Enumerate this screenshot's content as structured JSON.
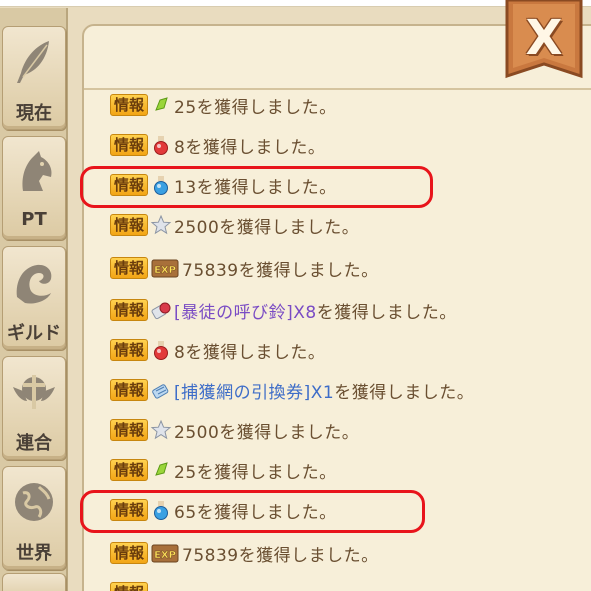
{
  "sidebar": {
    "items": [
      {
        "label": "現在",
        "icon": "feather-icon"
      },
      {
        "label": "PT",
        "icon": "horse-head-icon"
      },
      {
        "label": "ギルド",
        "icon": "dragon-icon"
      },
      {
        "label": "連合",
        "icon": "winged-emblem-icon"
      },
      {
        "label": "世界",
        "icon": "globe-icon"
      }
    ]
  },
  "close_button": {
    "label": "X"
  },
  "log": {
    "badge": "情報",
    "rows": [
      {
        "icon": "green-gem-icon",
        "text": "25を獲得しました。"
      },
      {
        "icon": "red-potion-icon",
        "text": "8を獲得しました。"
      },
      {
        "icon": "blue-potion-icon",
        "text": "13を獲得しました。"
      },
      {
        "icon": "silver-star-icon",
        "text": "2500を獲得しました。"
      },
      {
        "icon": "exp-scroll-icon",
        "exp_label": "EXP",
        "text": "75839を獲得しました。"
      },
      {
        "icon": "bell-ticket-icon",
        "item": "[暴徒の呼び鈴]X8",
        "item_color": "#7a4cc4",
        "text": "を獲得しました。"
      },
      {
        "icon": "red-potion-icon",
        "text": "8を獲得しました。"
      },
      {
        "icon": "net-ticket-icon",
        "item": "[捕獲網の引換券]X1",
        "item_color": "#3e6dc8",
        "text": "を獲得しました。"
      },
      {
        "icon": "silver-star-icon",
        "text": "2500を獲得しました。"
      },
      {
        "icon": "green-gem-icon",
        "text": "25を獲得しました。"
      },
      {
        "icon": "blue-potion-icon",
        "text": "65を獲得しました。"
      },
      {
        "icon": "exp-scroll-icon",
        "exp_label": "EXP",
        "text": "75839を獲得しました。"
      }
    ]
  },
  "highlight_color": "#e8141b",
  "colors": {
    "badge": "#f2a515",
    "text": "#6a4f31",
    "panel": "#f7efd9"
  }
}
